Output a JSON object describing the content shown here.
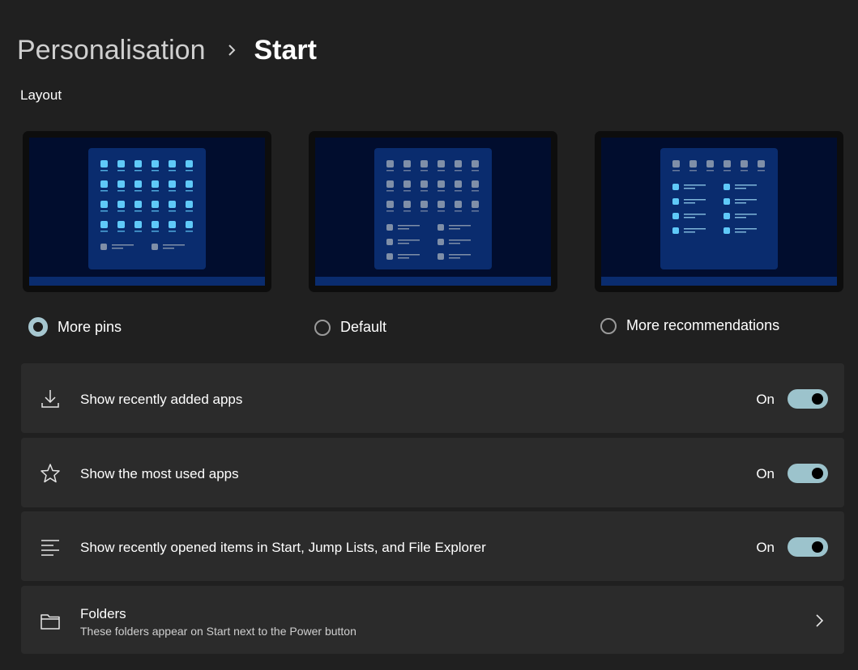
{
  "breadcrumb": {
    "parent": "Personalisation",
    "current": "Start"
  },
  "section": {
    "layout_label": "Layout"
  },
  "layouts": [
    {
      "label": "More pins",
      "selected": true,
      "pin_rows": 4,
      "rec_rows": 1,
      "highlight": "pins"
    },
    {
      "label": "Default",
      "selected": false,
      "pin_rows": 3,
      "rec_rows": 3,
      "highlight": "none"
    },
    {
      "label": "More recommendations",
      "selected": false,
      "pin_rows": 1,
      "rec_rows": 4,
      "highlight": "recs"
    }
  ],
  "settings": [
    {
      "icon": "download-icon",
      "label": "Show recently added apps",
      "state": "On"
    },
    {
      "icon": "star-icon",
      "label": "Show the most used apps",
      "state": "On"
    },
    {
      "icon": "list-icon",
      "label": "Show recently opened items in Start, Jump Lists, and File Explorer",
      "state": "On"
    }
  ],
  "folders": {
    "icon": "folder-icon",
    "title": "Folders",
    "subtitle": "These folders appear on Start next to the Power button"
  },
  "colors": {
    "background": "#202020",
    "card": "#2b2b2b",
    "toggle_on": "#9cc3cc",
    "radio_selected": "#a6c7d0",
    "preview_desktop": "#010d2e",
    "preview_startmenu": "#0a2c6e",
    "pin_highlight": "#5fc9f8",
    "pin_dim": "#7f8fa8"
  }
}
